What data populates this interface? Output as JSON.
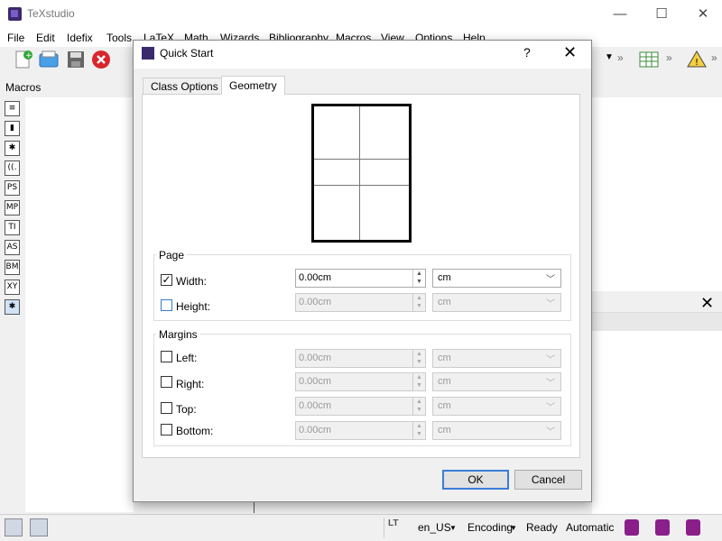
{
  "app": {
    "title": "TeXstudio",
    "window_controls": {
      "minimize": "—",
      "maximize": "☐",
      "close": "✕"
    }
  },
  "menu": {
    "items": [
      "File",
      "Edit",
      "Idefix",
      "Tools",
      "LaTeX",
      "Math",
      "Wizards",
      "Bibliography",
      "Macros",
      "View",
      "Options",
      "Help"
    ]
  },
  "left_dock": {
    "title": "Macros",
    "buttons": [
      "≡",
      "▮",
      "✱",
      "((.",
      "PS",
      "MP",
      "TI",
      "AS",
      "BM",
      "XY",
      "✱"
    ]
  },
  "toolbar": {
    "overflow": "»"
  },
  "dialog": {
    "title": "Quick Start",
    "help_label": "?",
    "close_label": "✕",
    "tabs": {
      "class_options": "Class Options",
      "geometry": "Geometry"
    },
    "page_group": {
      "title": "Page",
      "width": {
        "label": "Width:",
        "checked": true,
        "value": "0.00cm",
        "unit": "cm"
      },
      "height": {
        "label": "Height:",
        "checked": false,
        "value": "0.00cm",
        "unit": "cm"
      }
    },
    "margins_group": {
      "title": "Margins",
      "left": {
        "label": "Left:",
        "value": "0.00cm",
        "unit": "cm"
      },
      "right": {
        "label": "Right:",
        "value": "0.00cm",
        "unit": "cm"
      },
      "top": {
        "label": "Top:",
        "value": "0.00cm",
        "unit": "cm"
      },
      "bottom": {
        "label": "Bottom:",
        "value": "0.00cm",
        "unit": "cm"
      }
    },
    "ok_label": "OK",
    "cancel_label": "Cancel"
  },
  "status": {
    "language": "en_US",
    "encoding": "Encoding",
    "state": "Ready",
    "mode": "Automatic"
  },
  "colors": {
    "accent": "#3b7dd8",
    "logo": "#3b2a6b"
  }
}
